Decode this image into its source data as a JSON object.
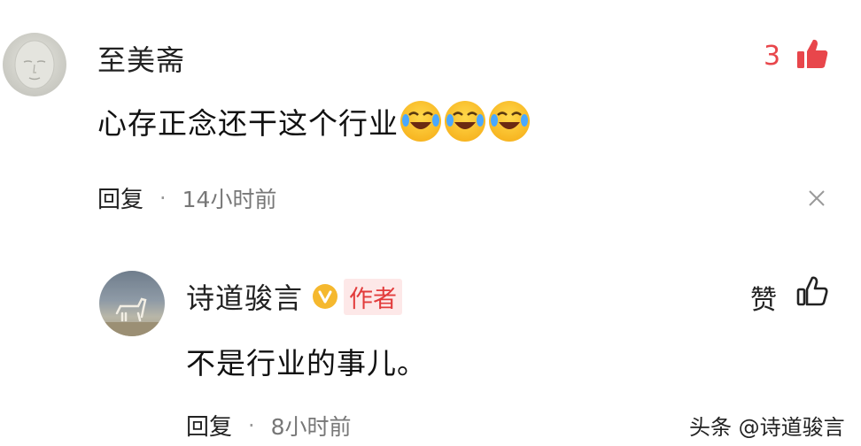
{
  "comment": {
    "username": "至美斋",
    "text": "心存正念还干这个行业",
    "like_count": "3",
    "reply_label": "回复",
    "separator": "·",
    "time": "14小时前",
    "emoji_count": 3,
    "like_icon": "thumbs-up-filled-icon",
    "close_icon": "close-icon"
  },
  "reply": {
    "username": "诗道骏言",
    "verified_icon": "verified-badge-icon",
    "author_tag": "作者",
    "text": "不是行业的事儿。",
    "like_label": "赞",
    "like_icon": "thumbs-up-outline-icon",
    "reply_label": "回复",
    "separator": "·",
    "time": "8小时前"
  },
  "watermark": "头条 @诗道骏言",
  "colors": {
    "accent": "#e8464b",
    "verified": "#f5b82e",
    "author_tag_bg": "#fde8e8"
  }
}
